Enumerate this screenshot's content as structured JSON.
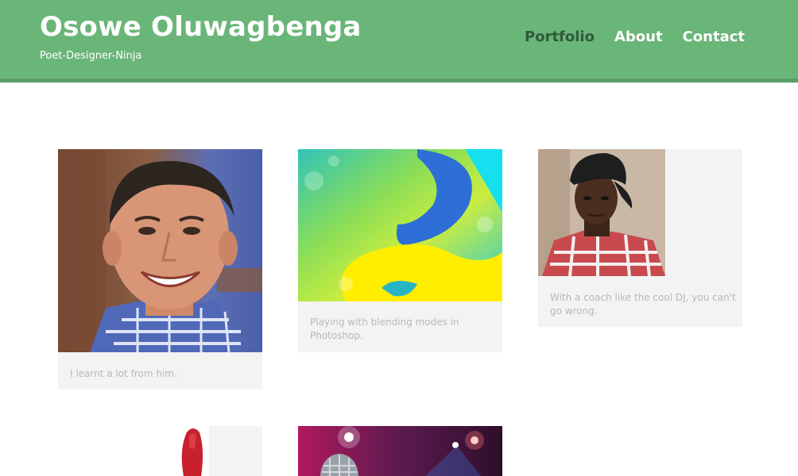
{
  "site": {
    "title": "Osowe Oluwagbenga",
    "tagline": "Poet-Designer-Ninja"
  },
  "nav": {
    "items": [
      {
        "label": "Portfolio",
        "active": true
      },
      {
        "label": "About",
        "active": false
      },
      {
        "label": "Contact",
        "active": false
      }
    ]
  },
  "colors": {
    "header_bg": "#6ab578",
    "header_border": "#5c9c68",
    "active_nav": "#2e5a3a",
    "caption_text": "#b8b8b8",
    "card_bg": "#f3f3f3"
  },
  "portfolio": [
    {
      "caption": "I learnt a lot from him.",
      "image": "smiling-man-photo"
    },
    {
      "caption": "Playing with blending modes in Photoshop.",
      "image": "abstract-gradient-artwork"
    },
    {
      "caption": "With a coach like the cool DJ, you can't go wrong.",
      "image": "man-in-cap-photo"
    },
    {
      "caption": "",
      "image": "red-object-photo"
    },
    {
      "caption": "",
      "image": "microphone-stage-photo"
    }
  ]
}
